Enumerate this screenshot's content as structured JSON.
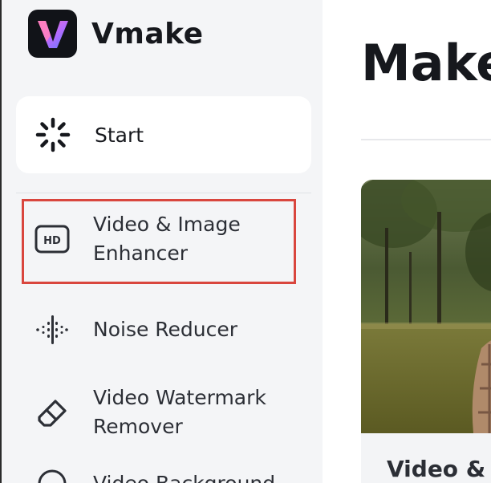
{
  "brand": {
    "name": "Vmake",
    "logo_icon": "vmake-logo-icon"
  },
  "sidebar": {
    "start": {
      "label": "Start",
      "icon": "loading-spinner-icon"
    },
    "items": [
      {
        "label": "Video & Image\nEnhancer",
        "icon": "hd-icon",
        "highlighted": true
      },
      {
        "label": "Noise Reducer",
        "icon": "sound-wave-icon"
      },
      {
        "label": "Video Watermark\nRemover",
        "icon": "eraser-icon"
      },
      {
        "label": "Video Background",
        "icon": "background-icon"
      }
    ]
  },
  "main": {
    "title": "Make",
    "card": {
      "title": "Video & I"
    }
  },
  "colors": {
    "highlight_border": "#d9463e",
    "sidebar_bg": "#f4f5f7",
    "text_dark": "#16181d"
  }
}
